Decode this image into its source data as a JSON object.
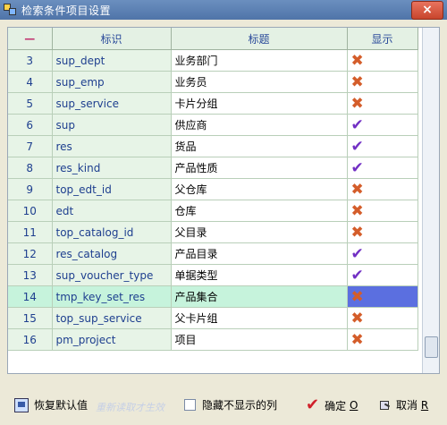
{
  "window": {
    "title": "检索条件项目设置",
    "close_glyph": "×"
  },
  "grid": {
    "columns": [
      "—",
      "标识",
      "标题",
      "显示"
    ],
    "rows": [
      {
        "index": "3",
        "code": "sup_dept",
        "title": "业务部门",
        "show": false
      },
      {
        "index": "4",
        "code": "sup_emp",
        "title": "业务员",
        "show": false
      },
      {
        "index": "5",
        "code": "sup_service",
        "title": "卡片分组",
        "show": false
      },
      {
        "index": "6",
        "code": "sup",
        "title": "供应商",
        "show": true
      },
      {
        "index": "7",
        "code": "res",
        "title": "货品",
        "show": true
      },
      {
        "index": "8",
        "code": "res_kind",
        "title": "产品性质",
        "show": true
      },
      {
        "index": "9",
        "code": "top_edt_id",
        "title": "父仓库",
        "show": false
      },
      {
        "index": "10",
        "code": "edt",
        "title": "仓库",
        "show": false
      },
      {
        "index": "11",
        "code": "top_catalog_id",
        "title": "父目录",
        "show": false
      },
      {
        "index": "12",
        "code": "res_catalog",
        "title": "产品目录",
        "show": true
      },
      {
        "index": "13",
        "code": "sup_voucher_type",
        "title": "单据类型",
        "show": true
      },
      {
        "index": "14",
        "code": "tmp_key_set_res",
        "title": "产品集合",
        "show": false,
        "selected": true
      },
      {
        "index": "15",
        "code": "top_sup_service",
        "title": "父卡片组",
        "show": false
      },
      {
        "index": "16",
        "code": "pm_project",
        "title": "项目",
        "show": false
      }
    ],
    "marks": {
      "yes": "✔",
      "no": "✖"
    }
  },
  "footer": {
    "restore_label": "恢复默认值",
    "hint": "重新读取才生效",
    "hide_label": "隐藏不显示的列",
    "ok_label": "确定",
    "ok_key": "O",
    "cancel_label": "取消",
    "cancel_key": "R"
  }
}
